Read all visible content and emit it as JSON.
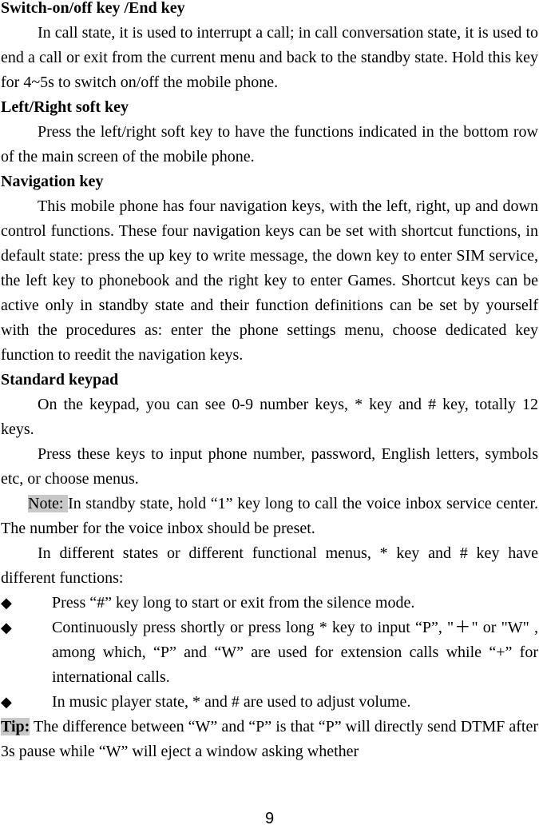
{
  "sections": [
    {
      "heading": "Switch-on/off key /End key",
      "paragraphs": [
        "In call state, it is used to interrupt a call; in call conversation state, it is used to end a call or exit from the current menu and back to the standby state. Hold this key for 4~5s to switch on/off the mobile phone."
      ]
    },
    {
      "heading": "Left/Right soft key",
      "paragraphs": [
        "Press the left/right soft key to have the functions indicated in the bottom row of the main screen of the mobile phone."
      ]
    },
    {
      "heading": "Navigation key",
      "paragraphs": [
        "This mobile phone has four navigation keys, with the left, right, up and down control functions. These four navigation keys can be set with shortcut functions, in default state: press the up key to write message, the down key to enter SIM service, the left key to phonebook and the right key to enter Games. Shortcut keys can be active only in standby state and their function definitions can be set by yourself with the procedures as: enter the phone settings menu, choose dedicated key function to reedit the navigation keys."
      ]
    },
    {
      "heading": "Standard keypad",
      "paragraphs": [
        "On the keypad, you can see 0-9 number keys, * key and # key, totally 12 keys.",
        "Press these keys to input phone number, password, English letters, symbols etc, or choose menus."
      ],
      "note": {
        "label": "Note: ",
        "text": "In standby state, hold “1” key long to call the voice inbox service center. The number for the voice inbox should be preset."
      },
      "after_note": "In different states or different functional menus, * key and # key have different functions:",
      "bullets": [
        "Press “#” key long to start or exit from the silence mode.",
        "Continuously press shortly or press long * key to input “P”, \"＋\" or \"W\" , among which, “P” and “W” are used for extension calls while “+” for international calls.",
        "In music player state, * and # are used to adjust volume."
      ],
      "bullet_icon": "◆"
    }
  ],
  "tip": {
    "label": "Tip:",
    "text": " The difference between “W” and “P” is that “P” will directly send DTMF after 3s pause while “W” will eject a window asking whether"
  },
  "page_number": "9"
}
